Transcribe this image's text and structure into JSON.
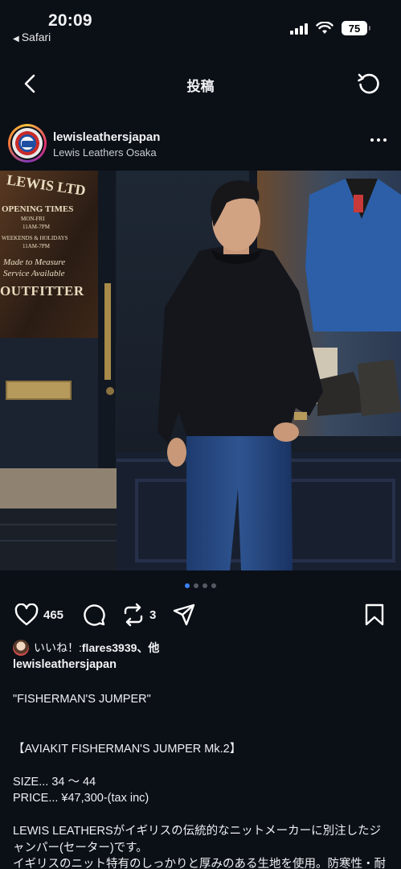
{
  "status": {
    "time": "20:09",
    "back_app": "Safari",
    "battery": "75"
  },
  "nav": {
    "title": "投稿"
  },
  "post": {
    "username": "lewisleathersjapan",
    "location": "Lewis Leathers Osaka",
    "photo": {
      "sign_top": "LEWIS LTD",
      "opening_title": "OPENING TIMES",
      "opening_days": "MON-FRI",
      "opening_hours": "11AM-7PM",
      "weekend_days": "WEEKENDS & HOLIDAYS",
      "weekend_hours": "11AM-7PM",
      "mtm_1": "Made to Measure",
      "mtm_2": "Service Available",
      "outfitter": "OUTFITTER"
    },
    "carousel": {
      "count": 4,
      "active": 0
    },
    "like_count": "465",
    "repost_count": "3",
    "liked_by_text": "いいね！: ",
    "liked_by_user": "flares3939",
    "liked_by_suffix": "、他",
    "caption_user": "lewisleathersjapan",
    "caption_lines": [
      "\"FISHERMAN'S JUMPER\"",
      "",
      "",
      "【AVIAKIT FISHERMAN'S JUMPER Mk.2】",
      "",
      "SIZE... 34 〜 44",
      "PRICE... ¥47,300-(tax inc)",
      "",
      "LEWIS LEATHERSがイギリスの伝統的なニットメーカーに別注したジャンパー(セーター)です。",
      "イギリスのニット特有のしっかりと厚みのある生地を使用。防寒性・耐"
    ]
  }
}
